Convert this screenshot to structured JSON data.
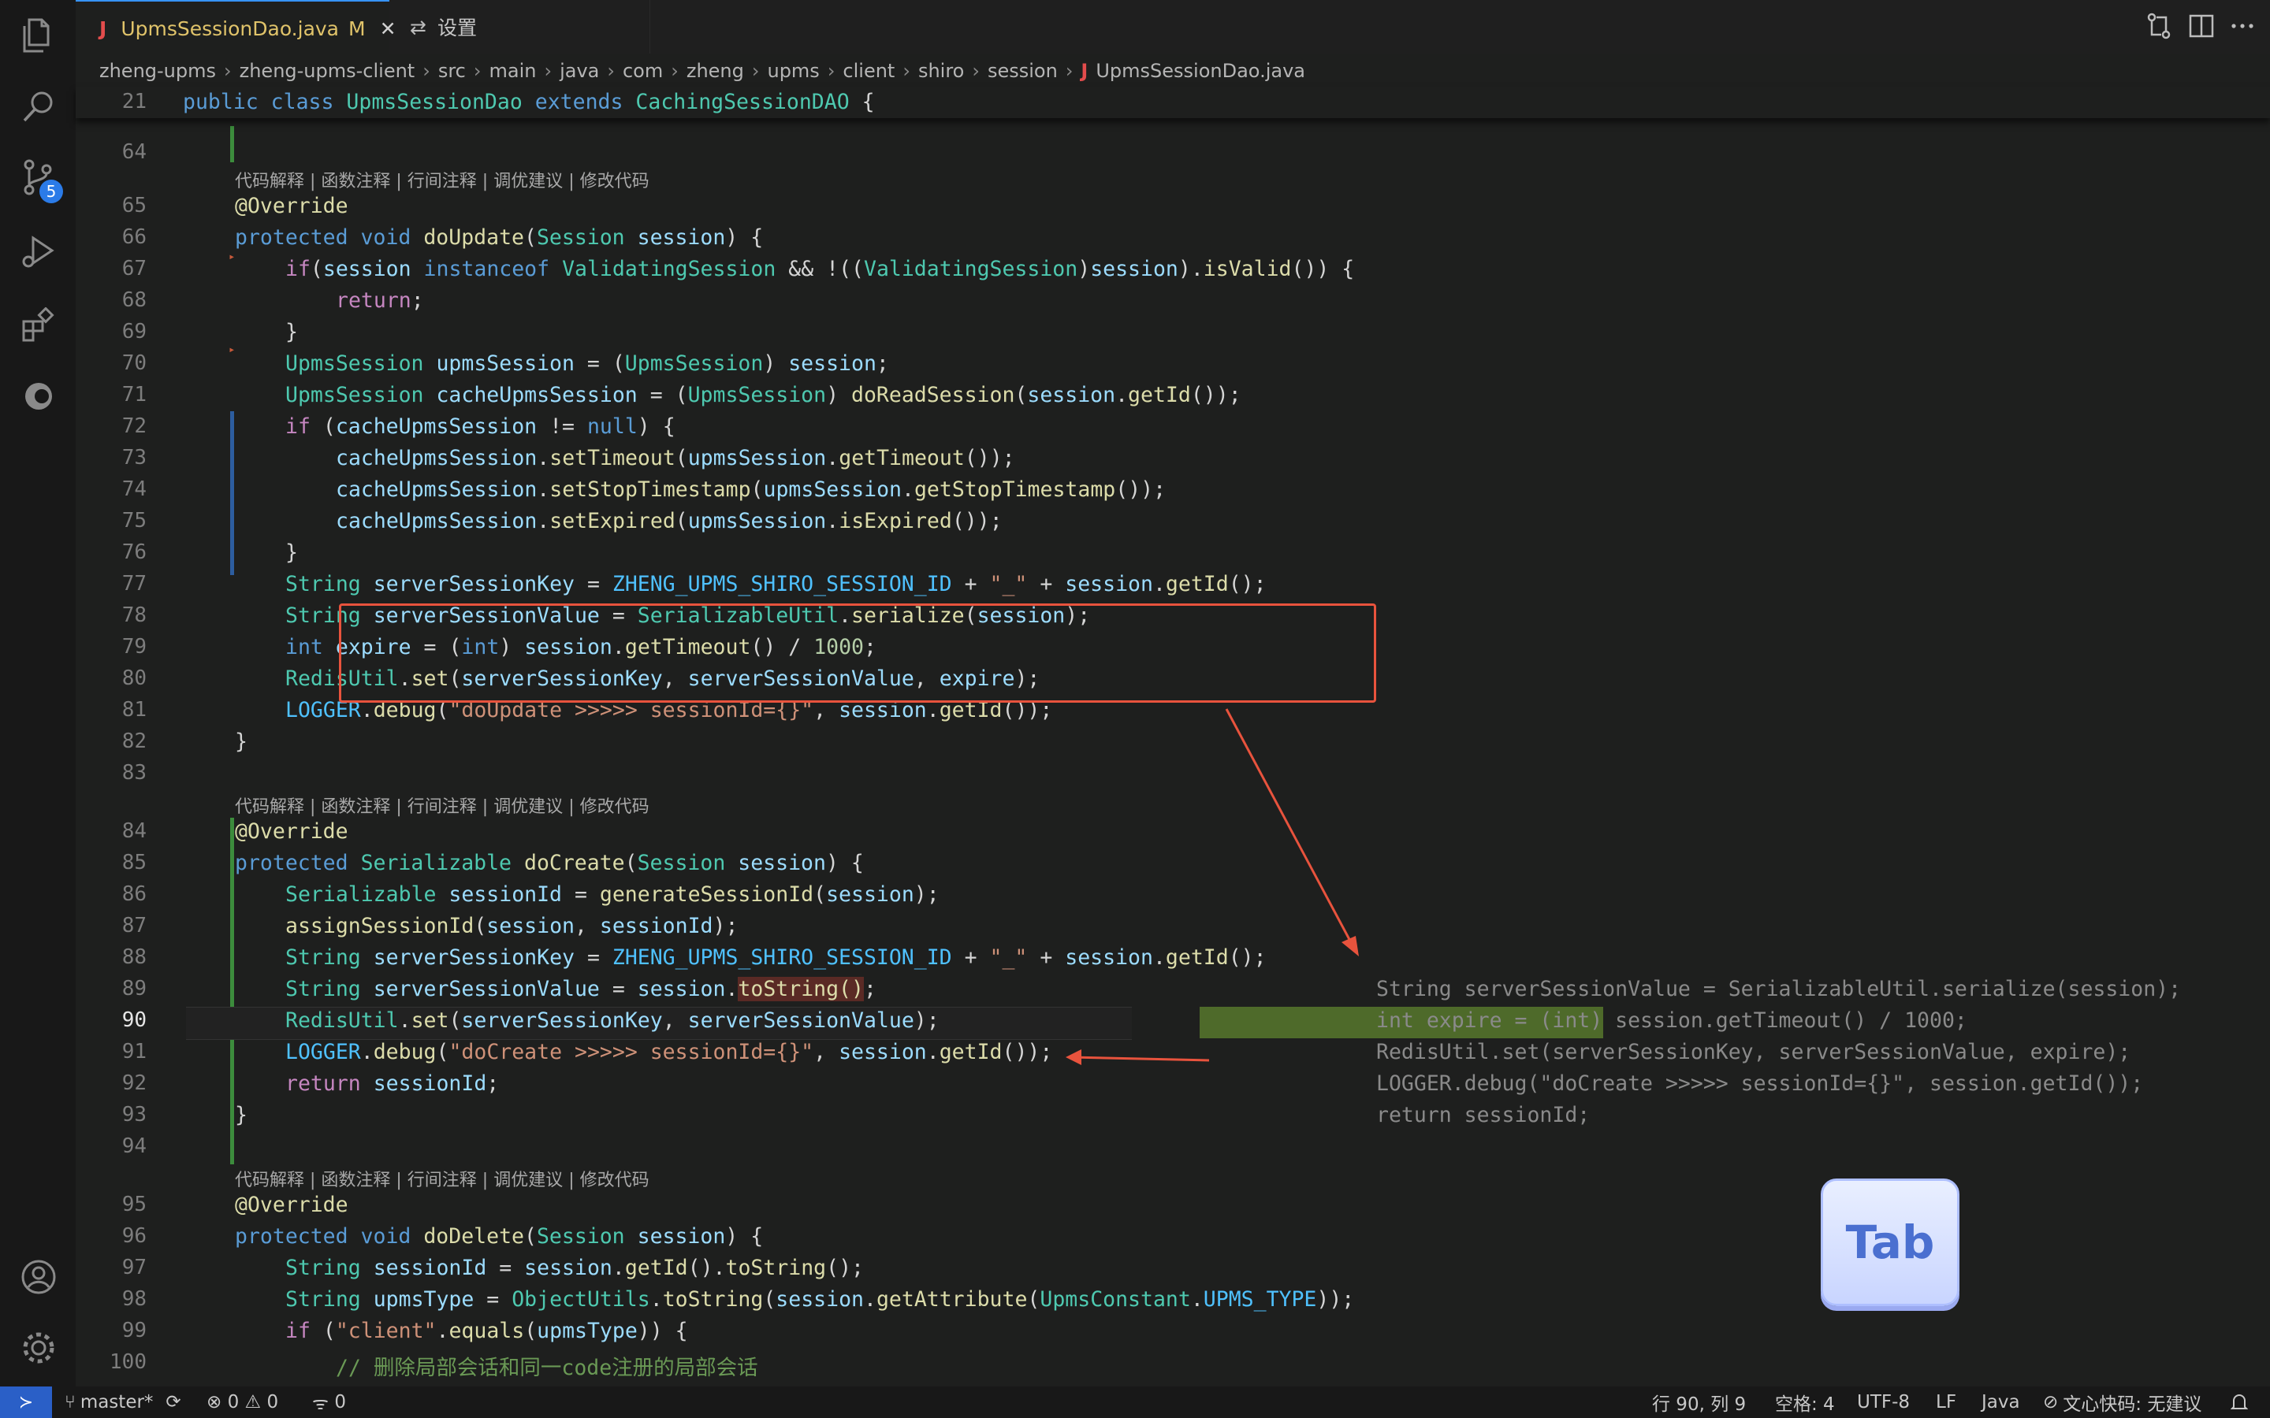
{
  "tabs": [
    {
      "icon": "J",
      "label": "UpmsSessionDao.java",
      "status": "M",
      "close": "✕"
    },
    {
      "icon": "⇄",
      "label": "设置"
    }
  ],
  "breadcrumb": [
    "zheng-upms",
    "zheng-upms-client",
    "src",
    "main",
    "java",
    "com",
    "zheng",
    "upms",
    "client",
    "shiro",
    "session"
  ],
  "breadcrumb_file": "UpmsSessionDao.java",
  "breadcrumb_file_icon": "J",
  "activity_badge": "5",
  "code_lens": "代码解释 | 函数注释 | 行间注释 | 调优建议 | 修改代码",
  "line_numbers": {
    "sticky": "21",
    "l64": "64",
    "l65": "65",
    "l66": "66",
    "l67": "67",
    "l68": "68",
    "l69": "69",
    "l70": "70",
    "l71": "71",
    "l72": "72",
    "l73": "73",
    "l74": "74",
    "l75": "75",
    "l76": "76",
    "l77": "77",
    "l78": "78",
    "l79": "79",
    "l80": "80",
    "l81": "81",
    "l82": "82",
    "l83": "83",
    "l84": "84",
    "l85": "85",
    "l86": "86",
    "l87": "87",
    "l88": "88",
    "l89": "89",
    "l90": "90",
    "l91": "91",
    "l92": "92",
    "l93": "93",
    "l94": "94",
    "l95": "95",
    "l96": "96",
    "l97": "97",
    "l98": "98",
    "l99": "99",
    "l100": "100"
  },
  "ghost_suggestion": [
    "String serverSessionValue = SerializableUtil.serialize(session);",
    "int expire = (int) session.getTimeout() / 1000;",
    "RedisUtil.set(serverSessionKey, serverSessionValue, expire);",
    "LOGGER.debug(\"doCreate >>>>> sessionId={}\", session.getId());",
    "return sessionId;"
  ],
  "tab_key_label": "Tab",
  "statusbar": {
    "branch": "master*",
    "errors": "0",
    "warnings": "0",
    "ports": "0",
    "position": "行 90, 列 9",
    "spaces": "空格: 4",
    "encoding": "UTF-8",
    "eol": "LF",
    "language": "Java",
    "assistant": "文心快码: 无建议"
  },
  "colors": {
    "accent": "#3794ff",
    "annotation": "#e8533d",
    "git_added": "#3c8c3c",
    "git_modified": "#2d5d9f",
    "suggestion_highlight": "#4e6a2a"
  }
}
